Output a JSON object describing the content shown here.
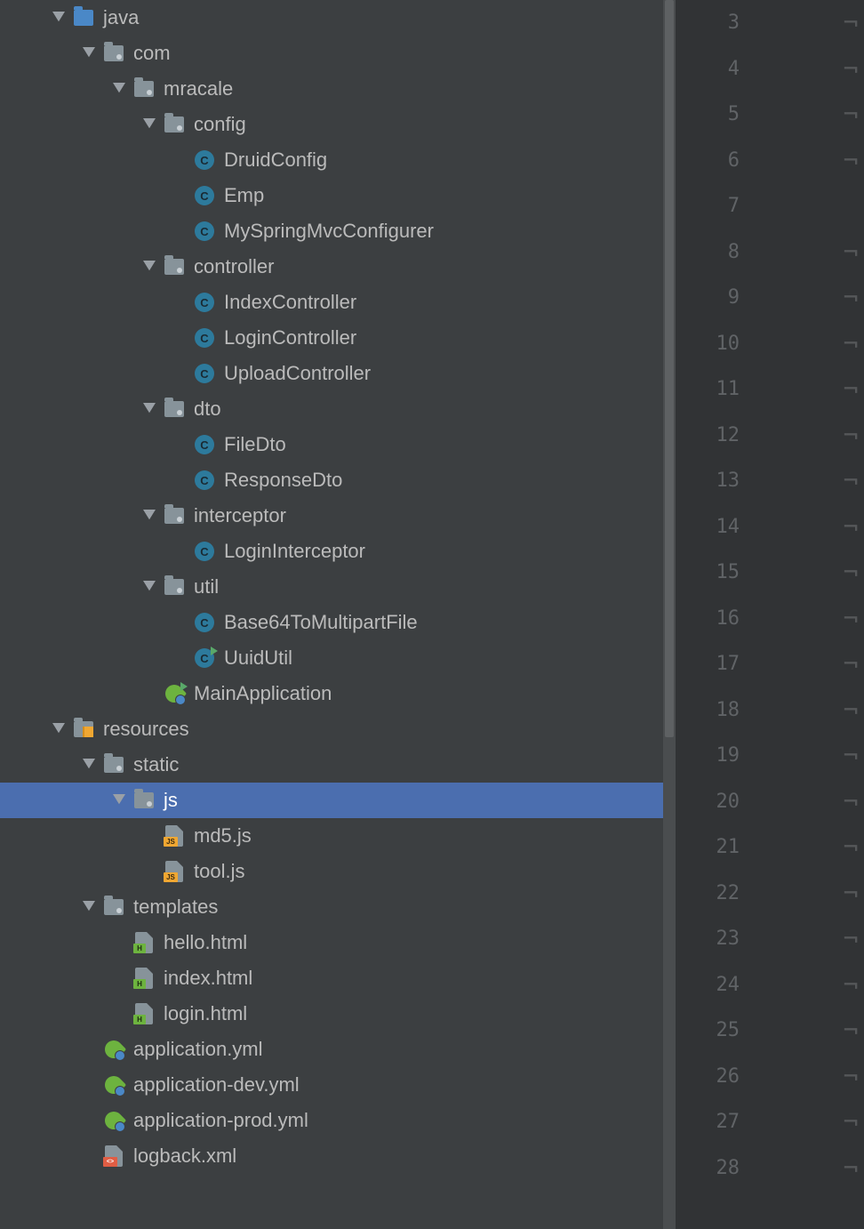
{
  "tree": [
    {
      "depth": 0,
      "chevron": true,
      "icon": "folder-blue",
      "label": "java",
      "selected": false
    },
    {
      "depth": 1,
      "chevron": true,
      "icon": "folder-pkg",
      "label": "com",
      "selected": false
    },
    {
      "depth": 2,
      "chevron": true,
      "icon": "folder-pkg",
      "label": "mracale",
      "selected": false
    },
    {
      "depth": 3,
      "chevron": true,
      "icon": "folder-pkg",
      "label": "config",
      "selected": false
    },
    {
      "depth": 4,
      "chevron": false,
      "icon": "class",
      "label": "DruidConfig",
      "selected": false
    },
    {
      "depth": 4,
      "chevron": false,
      "icon": "class",
      "label": "Emp",
      "selected": false
    },
    {
      "depth": 4,
      "chevron": false,
      "icon": "class",
      "label": "MySpringMvcConfigurer",
      "selected": false
    },
    {
      "depth": 3,
      "chevron": true,
      "icon": "folder-pkg",
      "label": "controller",
      "selected": false
    },
    {
      "depth": 4,
      "chevron": false,
      "icon": "class",
      "label": "IndexController",
      "selected": false
    },
    {
      "depth": 4,
      "chevron": false,
      "icon": "class",
      "label": "LoginController",
      "selected": false
    },
    {
      "depth": 4,
      "chevron": false,
      "icon": "class",
      "label": "UploadController",
      "selected": false
    },
    {
      "depth": 3,
      "chevron": true,
      "icon": "folder-pkg",
      "label": "dto",
      "selected": false
    },
    {
      "depth": 4,
      "chevron": false,
      "icon": "class",
      "label": "FileDto",
      "selected": false
    },
    {
      "depth": 4,
      "chevron": false,
      "icon": "class",
      "label": "ResponseDto",
      "selected": false
    },
    {
      "depth": 3,
      "chevron": true,
      "icon": "folder-pkg",
      "label": "interceptor",
      "selected": false
    },
    {
      "depth": 4,
      "chevron": false,
      "icon": "class",
      "label": "LoginInterceptor",
      "selected": false
    },
    {
      "depth": 3,
      "chevron": true,
      "icon": "folder-pkg",
      "label": "util",
      "selected": false
    },
    {
      "depth": 4,
      "chevron": false,
      "icon": "class",
      "label": "Base64ToMultipartFile",
      "selected": false
    },
    {
      "depth": 4,
      "chevron": false,
      "icon": "class-run",
      "label": "UuidUtil",
      "selected": false
    },
    {
      "depth": 3,
      "chevron": false,
      "icon": "spring-run",
      "label": "MainApplication",
      "selected": false
    },
    {
      "depth": 0,
      "chevron": true,
      "icon": "folder-res",
      "label": "resources",
      "selected": false
    },
    {
      "depth": 1,
      "chevron": true,
      "icon": "folder-pkg",
      "label": "static",
      "selected": false
    },
    {
      "depth": 2,
      "chevron": true,
      "icon": "folder-pkg",
      "label": "js",
      "selected": true
    },
    {
      "depth": 3,
      "chevron": false,
      "icon": "js",
      "label": "md5.js",
      "selected": false
    },
    {
      "depth": 3,
      "chevron": false,
      "icon": "js",
      "label": "tool.js",
      "selected": false
    },
    {
      "depth": 1,
      "chevron": true,
      "icon": "folder-pkg",
      "label": "templates",
      "selected": false
    },
    {
      "depth": 2,
      "chevron": false,
      "icon": "html",
      "label": "hello.html",
      "selected": false
    },
    {
      "depth": 2,
      "chevron": false,
      "icon": "html",
      "label": "index.html",
      "selected": false
    },
    {
      "depth": 2,
      "chevron": false,
      "icon": "html",
      "label": "login.html",
      "selected": false
    },
    {
      "depth": 1,
      "chevron": false,
      "icon": "spring",
      "label": "application.yml",
      "selected": false
    },
    {
      "depth": 1,
      "chevron": false,
      "icon": "spring",
      "label": "application-dev.yml",
      "selected": false
    },
    {
      "depth": 1,
      "chevron": false,
      "icon": "spring",
      "label": "application-prod.yml",
      "selected": false
    },
    {
      "depth": 1,
      "chevron": false,
      "icon": "xml",
      "label": "logback.xml",
      "selected": false
    }
  ],
  "gutter": {
    "start": 3,
    "end": 28,
    "mark_skip": [
      7
    ]
  },
  "indent_base": 56,
  "indent_step": 34
}
